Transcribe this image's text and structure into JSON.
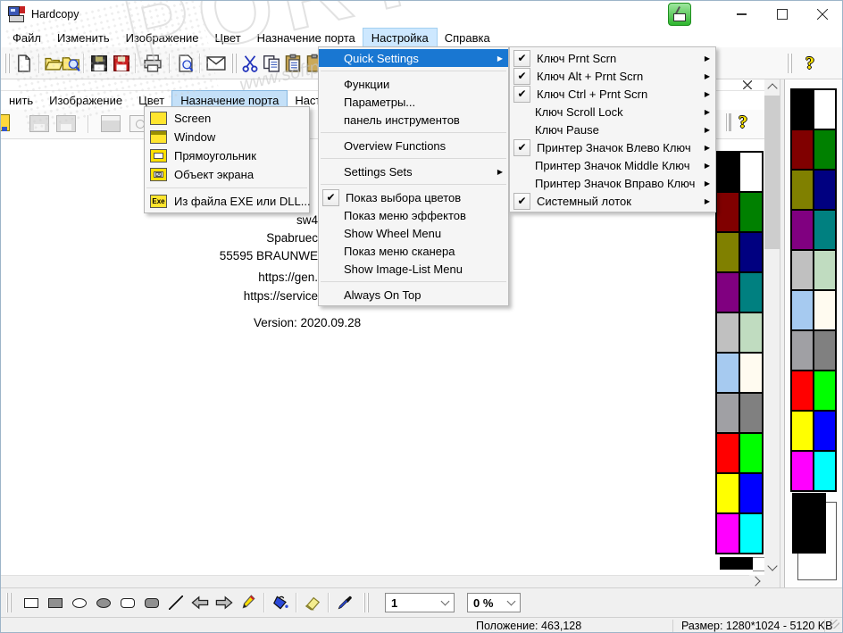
{
  "titlebar": {
    "title": "Hardcopy"
  },
  "menubar": {
    "items": [
      {
        "label": "Файл"
      },
      {
        "label": "Изменить"
      },
      {
        "label": "Изображение"
      },
      {
        "label": "Цвет"
      },
      {
        "label": "Назначение порта"
      },
      {
        "label": "Настройка",
        "highlighted": true
      },
      {
        "label": "Справка"
      }
    ]
  },
  "toolbar": {
    "help_label": "?"
  },
  "settings_menu": {
    "items": [
      {
        "label": "Quick Settings",
        "highlighted": true,
        "submenu": true
      },
      {
        "separator": true
      },
      {
        "label": "Функции"
      },
      {
        "label": "Параметры..."
      },
      {
        "label": "панель инструментов"
      },
      {
        "separator": true
      },
      {
        "label": "Overview Functions"
      },
      {
        "separator": true
      },
      {
        "label": "Settings Sets",
        "submenu": true
      },
      {
        "separator": true
      },
      {
        "label": "Показ выбора цветов",
        "checked": true
      },
      {
        "label": "Показ меню эффектов"
      },
      {
        "label": "Show Wheel Menu"
      },
      {
        "label": "Показ меню сканера"
      },
      {
        "label": "Show Image-List Menu"
      },
      {
        "separator": true
      },
      {
        "label": "Always On Top"
      }
    ]
  },
  "quick_settings_submenu": {
    "items": [
      {
        "label": "Ключ Prnt Scrn",
        "checked": true,
        "submenu": true
      },
      {
        "label": "Ключ Alt + Prnt Scrn",
        "checked": true,
        "submenu": true
      },
      {
        "label": "Ключ Ctrl + Prnt Scrn",
        "checked": true,
        "submenu": true
      },
      {
        "label": "Ключ Scroll Lock",
        "submenu": true
      },
      {
        "label": "Ключ Pause",
        "submenu": true
      },
      {
        "label": "Принтер Значок Влево Ключ",
        "checked": true,
        "submenu": true
      },
      {
        "label": "Принтер Значок Middle Ключ",
        "submenu": true
      },
      {
        "label": "Принтер Значок Вправо Ключ",
        "submenu": true
      },
      {
        "label": "Системный лоток",
        "checked": true,
        "submenu": true
      }
    ]
  },
  "inner_window": {
    "menubar": {
      "items": [
        {
          "label": "нить"
        },
        {
          "label": "Изображение"
        },
        {
          "label": "Цвет"
        },
        {
          "label": "Назначение порта",
          "highlighted": true
        },
        {
          "label": "Настройка"
        }
      ]
    },
    "port_menu": {
      "items": [
        {
          "label": "Screen",
          "icon": "screen-capture-icon"
        },
        {
          "label": "Window",
          "icon": "window-capture-icon"
        },
        {
          "label": "Прямоугольник",
          "icon": "rectangle-capture-icon"
        },
        {
          "label": "Объект экрана",
          "icon": "screen-object-icon"
        },
        {
          "separator": true
        },
        {
          "label": "Из файла EXE или DLL...",
          "icon": "exe-file-icon",
          "icon_text": "Exe"
        }
      ]
    },
    "canvas_lines": [
      "sw4",
      "Spabruec",
      "55595 BRAUNWE",
      "https://gen.",
      "https://service",
      "Version: 2020.09.28"
    ],
    "help_label": "?"
  },
  "palette": {
    "swatch_rows": [
      [
        "#000000",
        "#ffffff"
      ],
      [
        "#800000",
        "#008000"
      ],
      [
        "#808000",
        "#000080"
      ],
      [
        "#800080",
        "#008080"
      ],
      [
        "#c0c0c0",
        "#c0dcc0"
      ],
      [
        "#a6caf0",
        "#fffbf0"
      ],
      [
        "#a0a0a4",
        "#808080"
      ],
      [
        "#ff0000",
        "#00ff00"
      ],
      [
        "#ffff00",
        "#0000ff"
      ],
      [
        "#ff00ff",
        "#00ffff"
      ]
    ],
    "foreground": "#000000",
    "background": "#ffffff"
  },
  "bottom_toolbar": {
    "line_width_value": "1",
    "zoom_value": "0 %"
  },
  "statusbar": {
    "position": "Положение: 463,128",
    "size": "Размер: 1280*1024  -  5120 KB"
  },
  "watermark": {
    "big_text": "PORTAL",
    "tm": "™",
    "site": "www.softportal.com"
  },
  "icons": {
    "check": "✔",
    "submenu_arrow": "▶"
  },
  "colors": {
    "menu_selection": "#1977d2",
    "menubar_highlight": "#cde8ff",
    "inner_menubar_highlight": "#c4e0f8",
    "palette_grid_lines": "#000000"
  }
}
